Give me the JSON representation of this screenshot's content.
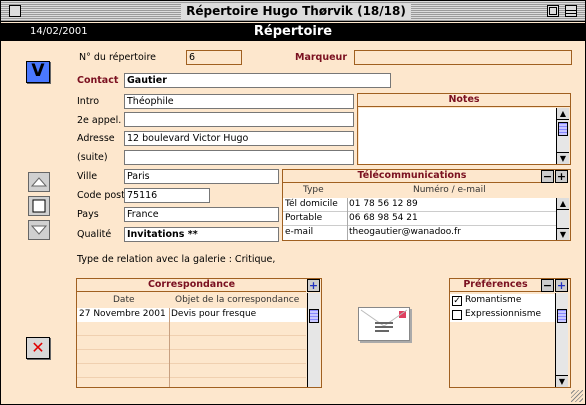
{
  "window": {
    "title": "Répertoire Hugo Thørvik (18/18)"
  },
  "header": {
    "date": "14/02/2001",
    "title": "Répertoire"
  },
  "form": {
    "num_label": "N° du répertoire",
    "num_value": "6",
    "marqueur_label": "Marqueur",
    "marqueur_value": "",
    "contact_label": "Contact",
    "contact_value": "Gautier",
    "intro_label": "Intro",
    "intro_value": "Théophile",
    "appel2_label": "2e appel.",
    "appel2_value": "",
    "adresse_label": "Adresse",
    "adresse_value": "12 boulevard Victor Hugo",
    "suite_label": "(suite)",
    "suite_value": "",
    "ville_label": "Ville",
    "ville_value": "Paris",
    "cp_label": "Code post.",
    "cp_value": "75116",
    "pays_label": "Pays",
    "pays_value": "France",
    "qualite_label": "Qualité",
    "qualite_value": "Invitations **",
    "relation_text": "Type de relation avec la galerie : Critique,"
  },
  "notes": {
    "title": "Notes",
    "text": ""
  },
  "telecom": {
    "title": "Télécommunications",
    "col_type": "Type",
    "col_num": "Numéro / e-mail",
    "rows": [
      {
        "type": "Tél domicile",
        "value": "01 78 56 12 89"
      },
      {
        "type": "Portable",
        "value": "06 68 98 54 21"
      },
      {
        "type": "e-mail",
        "value": "theogautier@wanadoo.fr"
      }
    ]
  },
  "correspondance": {
    "title": "Correspondance",
    "col_date": "Date",
    "col_obj": "Objet de la correspondance",
    "rows": [
      {
        "date": "27 Novembre 2001",
        "obj": "Devis pour fresque"
      }
    ]
  },
  "preferences": {
    "title": "Préférences",
    "items": [
      {
        "label": "Romantisme",
        "checked": true
      },
      {
        "label": "Expressionnisme",
        "checked": false
      }
    ]
  },
  "icons": {
    "validate": "V",
    "delete": "✕"
  },
  "colors": {
    "bg": "#fde7cd",
    "accent": "#7a1020",
    "validate_bg": "#4a78ff",
    "delete_color": "#e00000"
  }
}
